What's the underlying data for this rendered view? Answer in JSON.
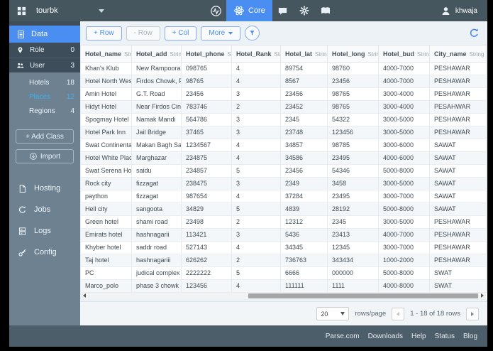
{
  "colors": {
    "accent": "#4a8ef2",
    "topbar_bg": "#46565f",
    "footer_bg": "#4d5e6b",
    "sidebar_bg": "#6d8191",
    "sidebar_dark_bg": "#3e4d5a",
    "places_blue": "#3fb0f2",
    "table_alt_row": "#f4f7f9"
  },
  "topbar": {
    "app_name": "tourbk",
    "core_label": "Core",
    "user_name": "khwaja",
    "icons": [
      "grid-icon",
      "chevron-down-icon",
      "pulse-icon",
      "core-atom-icon",
      "chat-icon",
      "gear-icon",
      "docs-icon",
      "user-avatar-icon"
    ]
  },
  "sidebar": {
    "data_label": "Data",
    "special_classes": [
      {
        "label": "Role",
        "count": "0",
        "icon": "pin-icon"
      },
      {
        "label": "User",
        "count": "3",
        "icon": "users-icon"
      }
    ],
    "classes": [
      {
        "label": "Hotels",
        "count": "18",
        "active": false
      },
      {
        "label": "Places",
        "count": "12",
        "active": true
      },
      {
        "label": "Regions",
        "count": "4",
        "active": false
      }
    ],
    "add_class_label": "+ Add Class",
    "import_label": "Import",
    "nav": [
      {
        "label": "Hosting",
        "icon": "hosting-icon"
      },
      {
        "label": "Jobs",
        "icon": "jobs-icon"
      },
      {
        "label": "Logs",
        "icon": "logs-icon"
      },
      {
        "label": "Config",
        "icon": "config-icon"
      }
    ]
  },
  "toolbar": {
    "add_row_label": "+ Row",
    "remove_row_label": "- Row",
    "add_col_label": "+ Col",
    "more_label": "More"
  },
  "table": {
    "columns": [
      {
        "name": "Hotel_name",
        "type": "String"
      },
      {
        "name": "Hotel_add",
        "type": "String"
      },
      {
        "name": "Hotel_phone",
        "type": "String"
      },
      {
        "name": "Hotel_Rank",
        "type": "String"
      },
      {
        "name": "Hotel_lat",
        "type": "String"
      },
      {
        "name": "Hotel_long",
        "type": "String"
      },
      {
        "name": "Hotel_bud",
        "type": "String"
      },
      {
        "name": "City_name",
        "type": "String"
      }
    ],
    "rows": [
      [
        "Khan's Klub",
        "New Rampoora Gate",
        "098765",
        "4",
        "89754",
        "98760",
        "4000-7000",
        "PESHAWAR"
      ],
      [
        "Hotel North West He...",
        "Firdos Chowk, Pesh...",
        "98765",
        "4",
        "8567",
        "23456",
        "4000-7000",
        "PESHAWAR"
      ],
      [
        "Amin Hotel",
        "G.T. Road",
        "23456",
        "3",
        "23456",
        "98765",
        "3000-4000",
        "PESHAWAR"
      ],
      [
        "Hidyt Hotel",
        "Near Firdos Cinema",
        "783746",
        "2",
        "23452",
        "98765",
        "3000-4000",
        "PESAHWAR"
      ],
      [
        "Spogmay Hotel",
        "Namak Mandi",
        "564786",
        "3",
        "2345",
        "54322",
        "3000-5000",
        "PESHAWAR"
      ],
      [
        "Hotel Park Inn",
        "Jail Bridge",
        "37465",
        "3",
        "23748",
        "123456",
        "3000-5000",
        "PESHAWAR"
      ],
      [
        "Swat Continental Ho...",
        "Makan Bagh Saidu S...",
        "1234567",
        "4",
        "34857",
        "98785",
        "3000-6000",
        "SAWAT"
      ],
      [
        "Hotel White Place",
        "Marghazar",
        "234875",
        "4",
        "34586",
        "23495",
        "4000-6000",
        "SAWAT"
      ],
      [
        "Swat Serena Hotel",
        "saidu",
        "234857",
        "5",
        "23456",
        "54346",
        "5000-8000",
        "SAWAT"
      ],
      [
        "Rock city",
        "fizzagat",
        "238475",
        "3",
        "2349",
        "3458",
        "3000-5000",
        "SAWAT"
      ],
      [
        "paython",
        "fizzagat",
        "987654",
        "4",
        "37284",
        "23495",
        "3000-7000",
        "SAWAT"
      ],
      [
        "Hell city",
        "sangoota",
        "34829",
        "5",
        "4839",
        "28192",
        "5000-8000",
        "SAWAT"
      ],
      [
        "Green hotel",
        "shami road",
        "23498",
        "2",
        "12312",
        "2345",
        "3000-5000",
        "PESHAWAR"
      ],
      [
        "Emirats hotel",
        "hashnagarii",
        "113421",
        "3",
        "5436",
        "23413",
        "4000-7000",
        "PESHAWAR"
      ],
      [
        "Khyber hotel",
        "saddr road",
        "527143",
        "4",
        "34345",
        "12345",
        "3000-7000",
        "PESHAWAR"
      ],
      [
        "Taj hotel",
        "hashnagariii",
        "626262",
        "2",
        "736763",
        "343434",
        "1000-2000",
        "PESHAWAR"
      ],
      [
        "PC",
        "judical complex",
        "2222222",
        "5",
        "6666",
        "000000",
        "5000-8000",
        "SWAT"
      ],
      [
        "Marco_polo",
        "phase 3 chowk",
        "123456",
        "4",
        "111111",
        "1111",
        "4000-8000",
        "SWAT"
      ]
    ]
  },
  "pagination": {
    "rows_per_page": "20",
    "rows_per_page_label": "rows/page",
    "range_label": "1 - 18 of 18 rows"
  },
  "footer": {
    "links": [
      "Parse.com",
      "Downloads",
      "Help",
      "Status",
      "Blog"
    ]
  }
}
